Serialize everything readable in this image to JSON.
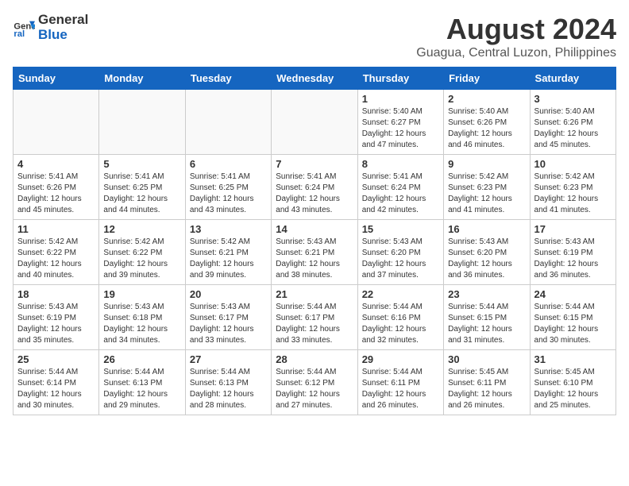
{
  "header": {
    "logo_general": "General",
    "logo_blue": "Blue",
    "main_title": "August 2024",
    "subtitle": "Guagua, Central Luzon, Philippines"
  },
  "calendar": {
    "days_of_week": [
      "Sunday",
      "Monday",
      "Tuesday",
      "Wednesday",
      "Thursday",
      "Friday",
      "Saturday"
    ],
    "weeks": [
      [
        {
          "day": "",
          "info": ""
        },
        {
          "day": "",
          "info": ""
        },
        {
          "day": "",
          "info": ""
        },
        {
          "day": "",
          "info": ""
        },
        {
          "day": "1",
          "info": "Sunrise: 5:40 AM\nSunset: 6:27 PM\nDaylight: 12 hours and 47 minutes."
        },
        {
          "day": "2",
          "info": "Sunrise: 5:40 AM\nSunset: 6:26 PM\nDaylight: 12 hours and 46 minutes."
        },
        {
          "day": "3",
          "info": "Sunrise: 5:40 AM\nSunset: 6:26 PM\nDaylight: 12 hours and 45 minutes."
        }
      ],
      [
        {
          "day": "4",
          "info": "Sunrise: 5:41 AM\nSunset: 6:26 PM\nDaylight: 12 hours and 45 minutes."
        },
        {
          "day": "5",
          "info": "Sunrise: 5:41 AM\nSunset: 6:25 PM\nDaylight: 12 hours and 44 minutes."
        },
        {
          "day": "6",
          "info": "Sunrise: 5:41 AM\nSunset: 6:25 PM\nDaylight: 12 hours and 43 minutes."
        },
        {
          "day": "7",
          "info": "Sunrise: 5:41 AM\nSunset: 6:24 PM\nDaylight: 12 hours and 43 minutes."
        },
        {
          "day": "8",
          "info": "Sunrise: 5:41 AM\nSunset: 6:24 PM\nDaylight: 12 hours and 42 minutes."
        },
        {
          "day": "9",
          "info": "Sunrise: 5:42 AM\nSunset: 6:23 PM\nDaylight: 12 hours and 41 minutes."
        },
        {
          "day": "10",
          "info": "Sunrise: 5:42 AM\nSunset: 6:23 PM\nDaylight: 12 hours and 41 minutes."
        }
      ],
      [
        {
          "day": "11",
          "info": "Sunrise: 5:42 AM\nSunset: 6:22 PM\nDaylight: 12 hours and 40 minutes."
        },
        {
          "day": "12",
          "info": "Sunrise: 5:42 AM\nSunset: 6:22 PM\nDaylight: 12 hours and 39 minutes."
        },
        {
          "day": "13",
          "info": "Sunrise: 5:42 AM\nSunset: 6:21 PM\nDaylight: 12 hours and 39 minutes."
        },
        {
          "day": "14",
          "info": "Sunrise: 5:43 AM\nSunset: 6:21 PM\nDaylight: 12 hours and 38 minutes."
        },
        {
          "day": "15",
          "info": "Sunrise: 5:43 AM\nSunset: 6:20 PM\nDaylight: 12 hours and 37 minutes."
        },
        {
          "day": "16",
          "info": "Sunrise: 5:43 AM\nSunset: 6:20 PM\nDaylight: 12 hours and 36 minutes."
        },
        {
          "day": "17",
          "info": "Sunrise: 5:43 AM\nSunset: 6:19 PM\nDaylight: 12 hours and 36 minutes."
        }
      ],
      [
        {
          "day": "18",
          "info": "Sunrise: 5:43 AM\nSunset: 6:19 PM\nDaylight: 12 hours and 35 minutes."
        },
        {
          "day": "19",
          "info": "Sunrise: 5:43 AM\nSunset: 6:18 PM\nDaylight: 12 hours and 34 minutes."
        },
        {
          "day": "20",
          "info": "Sunrise: 5:43 AM\nSunset: 6:17 PM\nDaylight: 12 hours and 33 minutes."
        },
        {
          "day": "21",
          "info": "Sunrise: 5:44 AM\nSunset: 6:17 PM\nDaylight: 12 hours and 33 minutes."
        },
        {
          "day": "22",
          "info": "Sunrise: 5:44 AM\nSunset: 6:16 PM\nDaylight: 12 hours and 32 minutes."
        },
        {
          "day": "23",
          "info": "Sunrise: 5:44 AM\nSunset: 6:15 PM\nDaylight: 12 hours and 31 minutes."
        },
        {
          "day": "24",
          "info": "Sunrise: 5:44 AM\nSunset: 6:15 PM\nDaylight: 12 hours and 30 minutes."
        }
      ],
      [
        {
          "day": "25",
          "info": "Sunrise: 5:44 AM\nSunset: 6:14 PM\nDaylight: 12 hours and 30 minutes."
        },
        {
          "day": "26",
          "info": "Sunrise: 5:44 AM\nSunset: 6:13 PM\nDaylight: 12 hours and 29 minutes."
        },
        {
          "day": "27",
          "info": "Sunrise: 5:44 AM\nSunset: 6:13 PM\nDaylight: 12 hours and 28 minutes."
        },
        {
          "day": "28",
          "info": "Sunrise: 5:44 AM\nSunset: 6:12 PM\nDaylight: 12 hours and 27 minutes."
        },
        {
          "day": "29",
          "info": "Sunrise: 5:44 AM\nSunset: 6:11 PM\nDaylight: 12 hours and 26 minutes."
        },
        {
          "day": "30",
          "info": "Sunrise: 5:45 AM\nSunset: 6:11 PM\nDaylight: 12 hours and 26 minutes."
        },
        {
          "day": "31",
          "info": "Sunrise: 5:45 AM\nSunset: 6:10 PM\nDaylight: 12 hours and 25 minutes."
        }
      ]
    ]
  }
}
